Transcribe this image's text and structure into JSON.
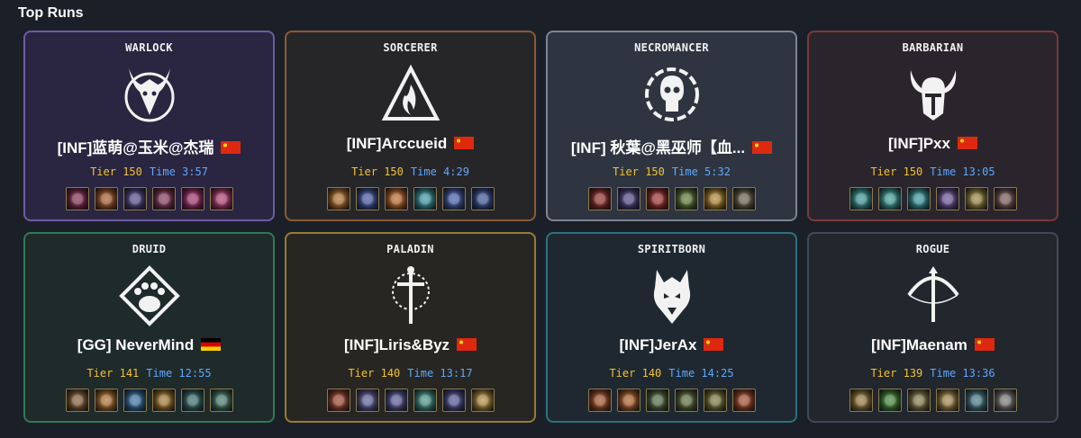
{
  "header": {
    "title": "Top Runs"
  },
  "labels": {
    "tier": "Tier",
    "time": "Time"
  },
  "cards": [
    {
      "class": "WARLOCK",
      "icon": "warlock-emblem-icon",
      "player": "[INF]蓝萌@玉米@杰瑞",
      "flag": "china-flag-icon",
      "tier": "150",
      "time": "3:57",
      "skills": [
        "#8a1c4a",
        "#b5561c",
        "#4b3f8f",
        "#8a2a55",
        "#b0206a",
        "#c23070"
      ]
    },
    {
      "class": "SORCERER",
      "icon": "sorcerer-emblem-icon",
      "player": "[INF]Arccueid",
      "flag": "china-flag-icon",
      "tier": "150",
      "time": "4:29",
      "skills": [
        "#c0701e",
        "#3a4fae",
        "#d06818",
        "#2aa0b0",
        "#3a58b8",
        "#2e4aa0"
      ]
    },
    {
      "class": "NECROMANCER",
      "icon": "necromancer-emblem-icon",
      "player": "[INF] 秋葉@黑巫师【血...",
      "flag": "china-flag-icon",
      "tier": "150",
      "time": "5:32",
      "skills": [
        "#9a1e1e",
        "#4a3c8a",
        "#a82020",
        "#5a7a2a",
        "#c08a20",
        "#6a5a40"
      ]
    },
    {
      "class": "BARBARIAN",
      "icon": "barbarian-emblem-icon",
      "player": "[INF]Pxx",
      "flag": "china-flag-icon",
      "tier": "150",
      "time": "13:05",
      "skills": [
        "#2aa0a0",
        "#30a8a0",
        "#28a0a8",
        "#6a4aa0",
        "#a08a30",
        "#7a5050"
      ]
    },
    {
      "class": "DRUID",
      "icon": "druid-emblem-icon",
      "player": "[GG] NeverMind",
      "flag": "germany-flag-icon",
      "tier": "141",
      "time": "12:55",
      "skills": [
        "#8a5a2a",
        "#c07020",
        "#2a70b0",
        "#b07a20",
        "#2a6a6a",
        "#3a7a6a"
      ]
    },
    {
      "class": "PALADIN",
      "icon": "paladin-emblem-icon",
      "player": "[INF]Liris&Byz",
      "flag": "china-flag-icon",
      "tier": "140",
      "time": "13:17",
      "skills": [
        "#a83a1e",
        "#5a5aa8",
        "#5050a0",
        "#3aa090",
        "#4a4aa0",
        "#c09030"
      ]
    },
    {
      "class": "SPIRITBORN",
      "icon": "spiritborn-emblem-icon",
      "player": "[INF]JerAx",
      "flag": "china-flag-icon",
      "tier": "140",
      "time": "14:25",
      "skills": [
        "#b04a1a",
        "#c05a1a",
        "#4a6a3a",
        "#5a6a30",
        "#7a7a30",
        "#b0401a"
      ]
    },
    {
      "class": "ROGUE",
      "icon": "rogue-emblem-icon",
      "player": "[INF]Maenam",
      "flag": "china-flag-icon",
      "tier": "139",
      "time": "13:36",
      "skills": [
        "#a07a30",
        "#3a8a2a",
        "#8a7a40",
        "#b08a40",
        "#3a7a8a",
        "#7a7a7a"
      ]
    }
  ]
}
